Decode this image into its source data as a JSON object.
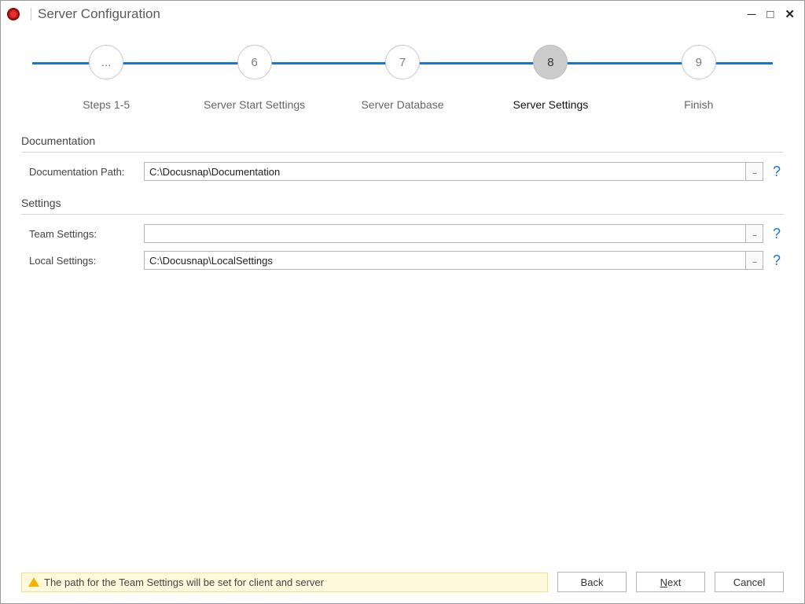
{
  "title": "Server Configuration",
  "steps": [
    {
      "symbol": "...",
      "label": "Steps 1-5"
    },
    {
      "symbol": "6",
      "label": "Server Start Settings"
    },
    {
      "symbol": "7",
      "label": "Server Database"
    },
    {
      "symbol": "8",
      "label": "Server Settings",
      "active": true
    },
    {
      "symbol": "9",
      "label": "Finish"
    }
  ],
  "sections": {
    "documentation": {
      "heading": "Documentation",
      "path_label": "Documentation Path:",
      "path_value": "C:\\Docusnap\\Documentation"
    },
    "settings": {
      "heading": "Settings",
      "team_label": "Team Settings:",
      "team_value": "",
      "local_label": "Local Settings:",
      "local_value": "C:\\Docusnap\\LocalSettings"
    }
  },
  "browse_glyph": "...",
  "help_glyph": "?",
  "status_text": "The path for the Team Settings will be set for client and server",
  "buttons": {
    "back": "Back",
    "next_prefix": "N",
    "next_rest": "ext",
    "cancel": "Cancel"
  }
}
